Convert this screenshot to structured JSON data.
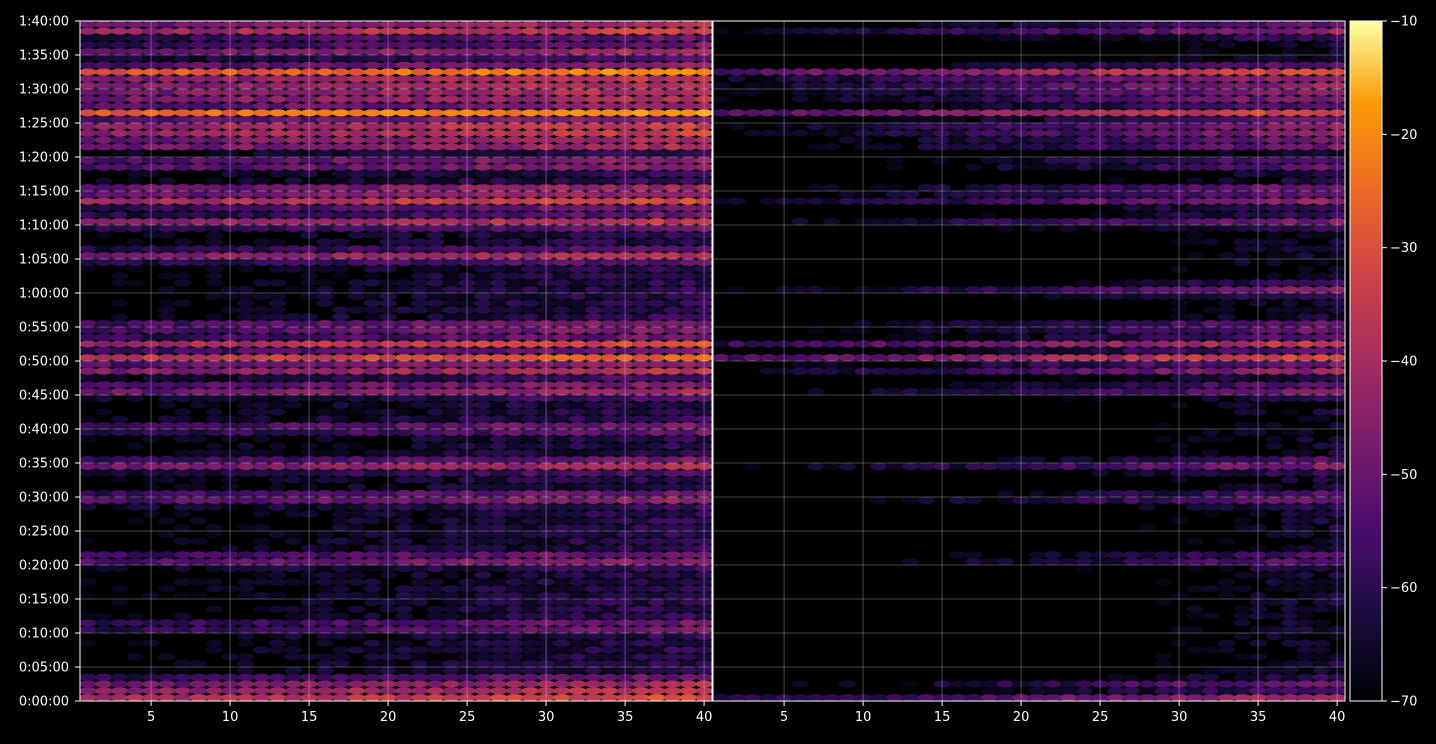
{
  "chart_data": {
    "type": "heatmap",
    "title": "",
    "panels": [
      {
        "name": "",
        "xlim": [
          1,
          40
        ],
        "x_ticks": [
          "5",
          "10",
          "15",
          "20",
          "25",
          "30",
          "35",
          "40"
        ],
        "x_tick_values": [
          5,
          10,
          15,
          20,
          25,
          30,
          35,
          40
        ]
      },
      {
        "name": "",
        "xlim": [
          1,
          40
        ],
        "x_ticks": [
          "5",
          "10",
          "15",
          "20",
          "25",
          "30",
          "35",
          "40"
        ],
        "x_tick_values": [
          5,
          10,
          15,
          20,
          25,
          30,
          35,
          40
        ]
      }
    ],
    "y_axis": {
      "label": "",
      "range_seconds": [
        0,
        6000
      ],
      "ticks": [
        "0:00:00",
        "0:05:00",
        "0:10:00",
        "0:15:00",
        "0:20:00",
        "0:25:00",
        "0:30:00",
        "0:35:00",
        "0:40:00",
        "0:45:00",
        "0:50:00",
        "0:55:00",
        "1:00:00",
        "1:05:00",
        "1:10:00",
        "1:15:00",
        "1:20:00",
        "1:25:00",
        "1:30:00",
        "1:35:00",
        "1:40:00"
      ]
    },
    "colorbar": {
      "colormap": "inferno",
      "range": [
        -70,
        -10
      ],
      "ticks": [
        "−70",
        "−60",
        "−50",
        "−40",
        "−30",
        "−20",
        "−10"
      ],
      "tick_values": [
        -70,
        -60,
        -50,
        -40,
        -30,
        -20,
        -10
      ]
    },
    "grid": true,
    "rows_per_panel": 100,
    "left_panel_row_levels_dB": {
      "baseline": -66,
      "bright_bands": [
        {
          "time": "0:00:30",
          "level": -40
        },
        {
          "time": "0:01:30",
          "level": -44
        },
        {
          "time": "0:02:40",
          "level": -46
        },
        {
          "time": "0:11:00",
          "level": -52
        },
        {
          "time": "0:20:50",
          "level": -48
        },
        {
          "time": "0:29:50",
          "level": -48
        },
        {
          "time": "0:34:40",
          "level": -45
        },
        {
          "time": "0:40:10",
          "level": -52
        },
        {
          "time": "0:45:50",
          "level": -44
        },
        {
          "time": "0:48:50",
          "level": -40
        },
        {
          "time": "0:50:30",
          "level": -36
        },
        {
          "time": "0:52:30",
          "level": -40
        },
        {
          "time": "0:55:00",
          "level": -48
        },
        {
          "time": "1:05:30",
          "level": -46
        },
        {
          "time": "1:10:30",
          "level": -44
        },
        {
          "time": "1:13:30",
          "level": -40
        },
        {
          "time": "1:15:00",
          "level": -42
        },
        {
          "time": "1:19:00",
          "level": -46
        },
        {
          "time": "1:22:00",
          "level": -40
        },
        {
          "time": "1:24:00",
          "level": -32
        },
        {
          "time": "1:26:30",
          "level": -28
        },
        {
          "time": "1:29:00",
          "level": -38
        },
        {
          "time": "1:31:00",
          "level": -36
        },
        {
          "time": "1:32:30",
          "level": -30
        },
        {
          "time": "1:35:40",
          "level": -46
        },
        {
          "time": "1:38:30",
          "level": -42
        },
        {
          "time": "1:40:00",
          "level": -40
        }
      ]
    },
    "right_panel_row_levels_dB": {
      "baseline": -70,
      "bright_bands": [
        {
          "time": "0:00:30",
          "level": -48
        },
        {
          "time": "0:02:20",
          "level": -54
        },
        {
          "time": "0:20:50",
          "level": -56
        },
        {
          "time": "0:29:50",
          "level": -54
        },
        {
          "time": "0:34:40",
          "level": -52
        },
        {
          "time": "0:45:50",
          "level": -52
        },
        {
          "time": "0:48:50",
          "level": -46
        },
        {
          "time": "0:50:30",
          "level": -40
        },
        {
          "time": "0:52:30",
          "level": -44
        },
        {
          "time": "0:55:00",
          "level": -52
        },
        {
          "time": "1:00:30",
          "level": -54
        },
        {
          "time": "1:10:30",
          "level": -54
        },
        {
          "time": "1:13:30",
          "level": -52
        },
        {
          "time": "1:15:00",
          "level": -50
        },
        {
          "time": "1:19:00",
          "level": -54
        },
        {
          "time": "1:22:00",
          "level": -50
        },
        {
          "time": "1:24:00",
          "level": -44
        },
        {
          "time": "1:26:30",
          "level": -40
        },
        {
          "time": "1:29:00",
          "level": -46
        },
        {
          "time": "1:31:00",
          "level": -42
        },
        {
          "time": "1:32:30",
          "level": -40
        },
        {
          "time": "1:38:30",
          "level": -52
        },
        {
          "time": "1:40:00",
          "level": -54
        }
      ]
    }
  }
}
